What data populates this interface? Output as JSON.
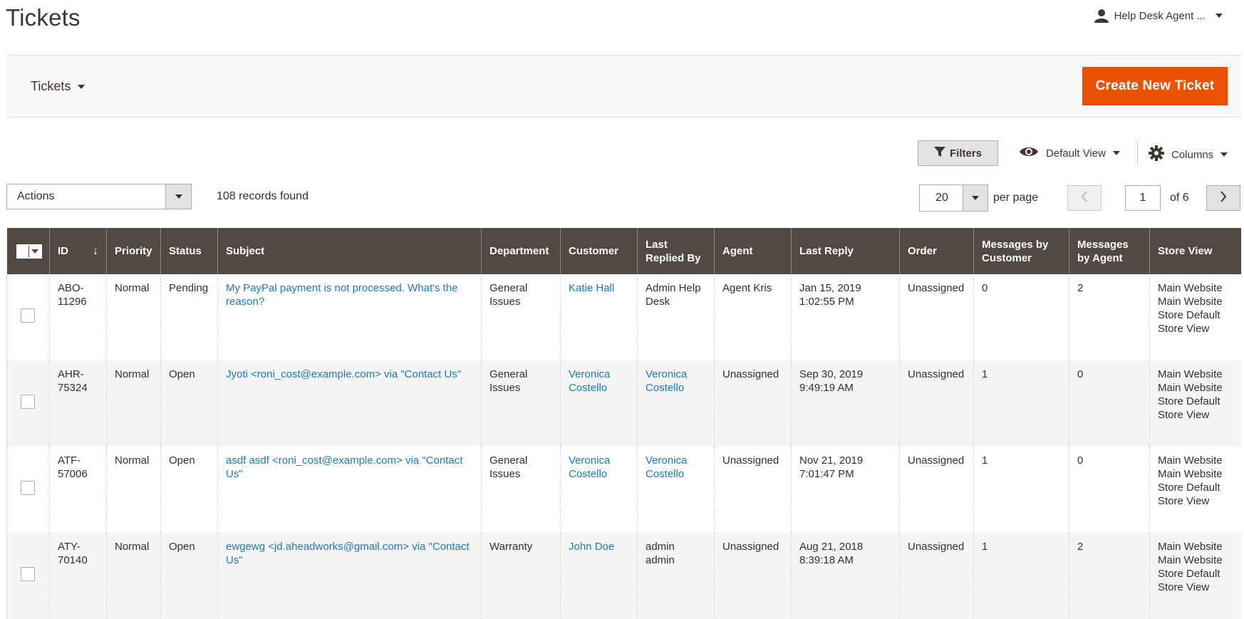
{
  "page": {
    "title": "Tickets"
  },
  "user": {
    "name": "Help Desk Agent ..."
  },
  "topbar": {
    "switcher_label": "Tickets",
    "create_button": "Create New Ticket"
  },
  "toolbar": {
    "filters": "Filters",
    "view": "Default View",
    "columns": "Columns"
  },
  "actions": {
    "label": "Actions",
    "records": "108 records found"
  },
  "pager": {
    "per_page_value": "20",
    "per_page_label": "per page",
    "current_page": "1",
    "of_total": "of 6"
  },
  "columns": [
    "ID",
    "Priority",
    "Status",
    "Subject",
    "Department",
    "Customer",
    "Last Replied By",
    "Agent",
    "Last Reply",
    "Order",
    "Messages by Customer",
    "Messages by Agent",
    "Store View"
  ],
  "colors": {
    "accent": "#eb5202",
    "header_bg": "#514943",
    "link": "#1979c3",
    "warning": "#b5332a"
  },
  "rows": [
    {
      "id": "ABO-11296",
      "priority": "Normal",
      "status": "Pending",
      "subject": "My PayPal payment is not processed. What's the reason?",
      "department": "General Issues",
      "customer": "Katie Hall",
      "last_replied_by": "Admin Help Desk",
      "agent": "Agent Kris",
      "last_reply": "Jan 15, 2019 1:02:55 PM",
      "order": "Unassigned",
      "msgs_customer": "0",
      "msgs_agent": "2",
      "store_view": "Main Website Main Website Store Default Store View"
    },
    {
      "id": "AHR-75324",
      "priority": "Normal",
      "status": "Open",
      "subject": "Jyoti <roni_cost@example.com> via \"Contact Us\"",
      "department": "General Issues",
      "customer": "Veronica Costello",
      "last_replied_by": "Veronica Costello",
      "agent": "Unassigned",
      "last_reply": "Sep 30, 2019 9:49:19 AM",
      "order": "Unassigned",
      "msgs_customer": "1",
      "msgs_agent": "0",
      "store_view": "Main Website Main Website Store Default Store View"
    },
    {
      "id": "ATF-57006",
      "priority": "Normal",
      "status": "Open",
      "subject": "asdf asdf <roni_cost@example.com> via \"Contact Us\"",
      "department": "General Issues",
      "customer": "Veronica Costello",
      "last_replied_by": "Veronica Costello",
      "agent": "Unassigned",
      "last_reply": "Nov 21, 2019 7:01:47 PM",
      "order": "Unassigned",
      "msgs_customer": "1",
      "msgs_agent": "0",
      "store_view": "Main Website Main Website Store Default Store View"
    },
    {
      "id": "ATY-70140",
      "priority": "Normal",
      "status": "Open",
      "subject": "ewgewg <jd.aheadworks@gmail.com> via \"Contact Us\"",
      "department": "Warranty",
      "customer": "John Doe",
      "last_replied_by": "admin admin",
      "agent": "Unassigned",
      "last_reply": "Aug 21, 2018 8:39:18 AM",
      "order": "Unassigned",
      "msgs_customer": "1",
      "msgs_agent": "2",
      "store_view": "Main Website Main Website Store Default Store View"
    }
  ]
}
